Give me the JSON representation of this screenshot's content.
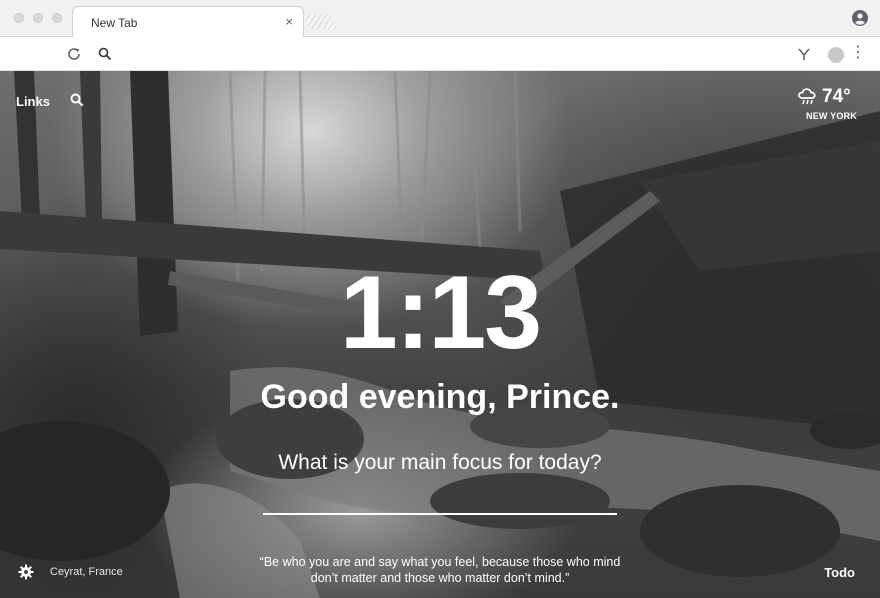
{
  "browser": {
    "tab_title": "New Tab",
    "tab_close": "×",
    "menu_glyph": "⋮",
    "icons": [
      "close-window-dot",
      "minimize-window-dot",
      "zoom-window-dot",
      "profile-icon",
      "reload-icon",
      "search-icon",
      "extension-icon",
      "menu-icon"
    ]
  },
  "top_left": {
    "links_label": "Links",
    "icon": "search-icon"
  },
  "weather": {
    "temperature": "74°",
    "location": "NEW YORK",
    "icon": "cloud-rain-icon"
  },
  "center": {
    "time": "1:13",
    "greeting": "Good evening, Prince.",
    "focus_question": "What is your main focus for today?",
    "focus_value": ""
  },
  "bottom": {
    "settings_icon": "gear-icon",
    "photo_location": "Ceyrat, France",
    "quote_line1": "“Be who you are and say what you feel, because those who mind",
    "quote_line2": "don’t matter and those who matter don’t mind.”",
    "todo_label": "Todo"
  },
  "colors": {
    "text": "#ffffff",
    "chrome_bg": "#f1f1f1",
    "tab_bg": "#ffffff"
  }
}
